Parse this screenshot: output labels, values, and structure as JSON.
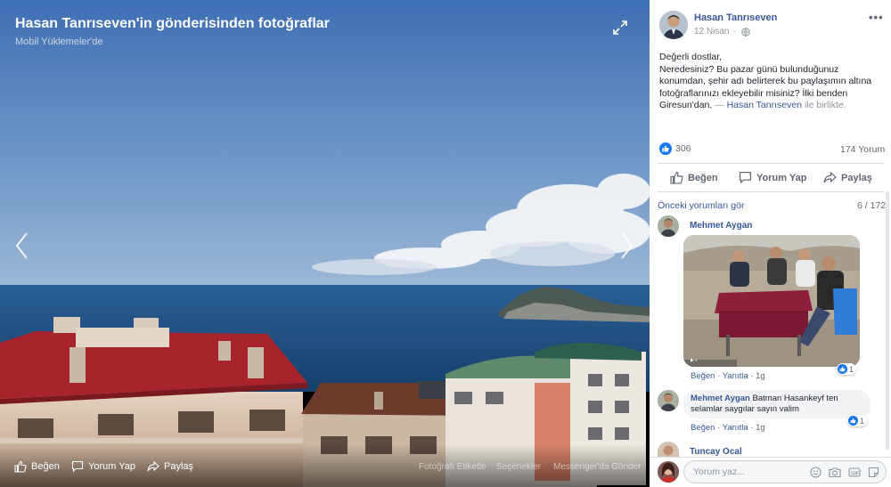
{
  "viewer": {
    "title": "Hasan Tanrıseven'in gönderisinden fotoğraflar",
    "album": "Mobil Yüklemeler'de",
    "actions": {
      "like": "Beğen",
      "comment": "Yorum Yap",
      "share": "Paylaş"
    },
    "faint_actions": {
      "tag": "Fotoğrafı Etiketle",
      "options": "Seçenekler",
      "messenger": "Messenger'da Gönder"
    },
    "icons": [
      "expand-icon",
      "prev-arrow-icon",
      "next-arrow-icon"
    ]
  },
  "post": {
    "author": "Hasan Tanrıseven",
    "date": "12 Nisan",
    "separator": "·",
    "text_line1": "Değerli dostlar,",
    "text_body": "Neredesiniz? Bu pazar günü bulunduğunuz konumdan, şehir adı belirterek bu paylaşımın altına fotoğraflarınızı ekleyebilir misiniz? İlki benden Giresun'dan.",
    "tag_prefix": "—",
    "tag_name": "Hasan Tanrıseven",
    "tag_suffix": "ile birlikte.",
    "more": "•••",
    "reaction_count": "306",
    "comment_count": "174 Yorum",
    "buttons": {
      "like": "Beğen",
      "comment": "Yorum Yap",
      "share": "Paylaş"
    }
  },
  "comments_header": {
    "earlier": "Önceki yorumları gör",
    "pager": "6 / 172"
  },
  "comments": [
    {
      "name": "Mehmet Aygan",
      "text": "",
      "like": "Beğen",
      "reply": "Yanıtla",
      "dot": "·",
      "time": "1g",
      "reactions": "1"
    },
    {
      "name": "Mehmet Aygan",
      "text": "Batman Hasankeyf ten selamlar saygılar sayın valim",
      "like": "Beğen",
      "reply": "Yanıtla",
      "dot": "·",
      "time": "1g",
      "reactions": "1"
    },
    {
      "name": "Tuncay Ocal"
    }
  ],
  "composer": {
    "placeholder": "Yorum yaz..."
  },
  "colors": {
    "link": "#365899",
    "like_blue": "#1877f2",
    "roof_red": "#a8242c",
    "sea": "#1e4f82"
  }
}
